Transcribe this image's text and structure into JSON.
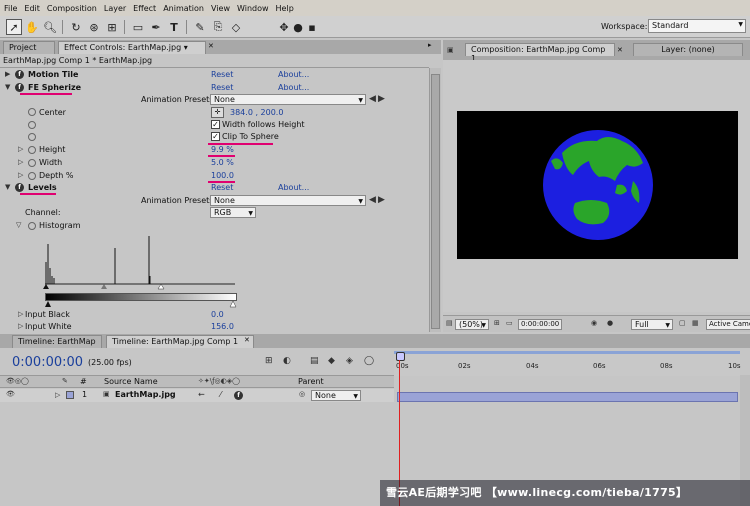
{
  "menu": [
    "File",
    "Edit",
    "Composition",
    "Layer",
    "Effect",
    "Animation",
    "View",
    "Window",
    "Help"
  ],
  "workspace": {
    "label": "Workspace:",
    "value": "Standard"
  },
  "left_panel": {
    "tabs": [
      "Project",
      "Effect Controls: EarthMap.jpg"
    ],
    "breadcrumb": "EarthMap.jpg Comp 1 * EarthMap.jpg",
    "effects": {
      "motion_tile": {
        "name": "Motion Tile",
        "reset": "Reset",
        "about": "About..."
      },
      "fe_spherize": {
        "name": "FE Spherize",
        "reset": "Reset",
        "about": "About...",
        "presets_label": "Animation Presets:",
        "presets_value": "None",
        "center_label": "Center",
        "center_value": "384.0 , 200.0",
        "width_follows_height": "Width follows Height",
        "clip_to_sphere": "Clip To Sphere",
        "height_label": "Height",
        "height_value": "9.9 %",
        "width_label": "Width",
        "width_value": "5.0 %",
        "depth_label": "Depth %",
        "depth_value": "100.0"
      },
      "levels": {
        "name": "Levels",
        "reset": "Reset",
        "about": "About...",
        "presets_label": "Animation Presets:",
        "presets_value": "None",
        "channel_label": "Channel:",
        "channel_value": "RGB",
        "histogram_label": "Histogram",
        "input_black_label": "Input Black",
        "input_black_value": "0.0",
        "input_white_label": "Input White",
        "input_white_value": "156.0"
      }
    }
  },
  "right_panel": {
    "tabs": [
      "Composition: EarthMap.jpg Comp 1",
      "Layer: (none)"
    ],
    "zoom": "(50%)",
    "time": "0:00:00:00",
    "resolution": "Full",
    "camera": "Active Camera"
  },
  "timeline": {
    "tabs": [
      "Timeline: EarthMap",
      "Timeline: EarthMap.jpg Comp 1"
    ],
    "current_time": "0:00:00:00",
    "fps": "(25.00 fps)",
    "col_hash": "#",
    "col_source": "Source Name",
    "col_parent": "Parent",
    "layer": {
      "index": "1",
      "name": "EarthMap.jpg",
      "parent": "None"
    },
    "ruler": [
      "00s",
      "02s",
      "04s",
      "06s",
      "08s",
      "10s"
    ]
  },
  "watermark": "雪云AE后期学习吧 【www.linecg.com/tieba/1775】",
  "colors": {
    "link": "#1a3f9c",
    "highlight": "#e00070",
    "sphere_blue": "#1c1fe0",
    "sphere_green": "#2aa52a"
  }
}
